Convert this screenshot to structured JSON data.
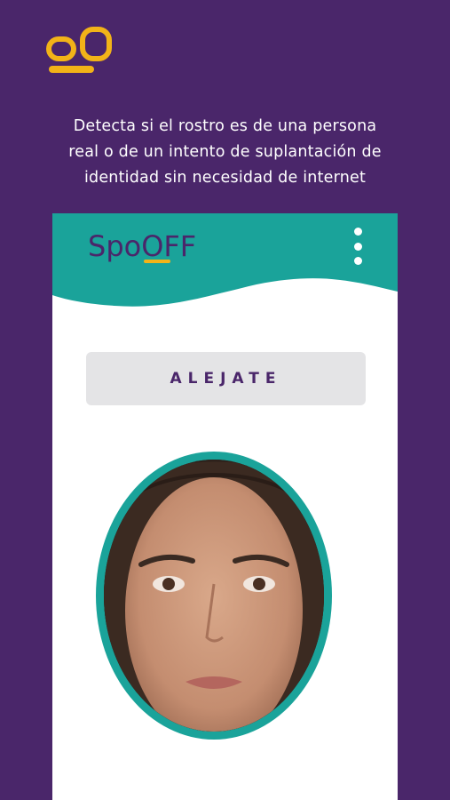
{
  "tagline": {
    "line1": "Detecta si el rostro es de una persona",
    "line2": "real o de un intento de suplantación de",
    "line3": "identidad sin necesidad de internet"
  },
  "app": {
    "logo_text": "SpoOFF",
    "instruction": "ALEJATE"
  },
  "colors": {
    "background": "#4a266a",
    "accent_teal": "#1aa39a",
    "accent_yellow": "#f2b318",
    "banner_bg": "#e4e4e6"
  },
  "icons": {
    "brand": "oo-logo-icon",
    "menu": "more-vertical-icon"
  }
}
